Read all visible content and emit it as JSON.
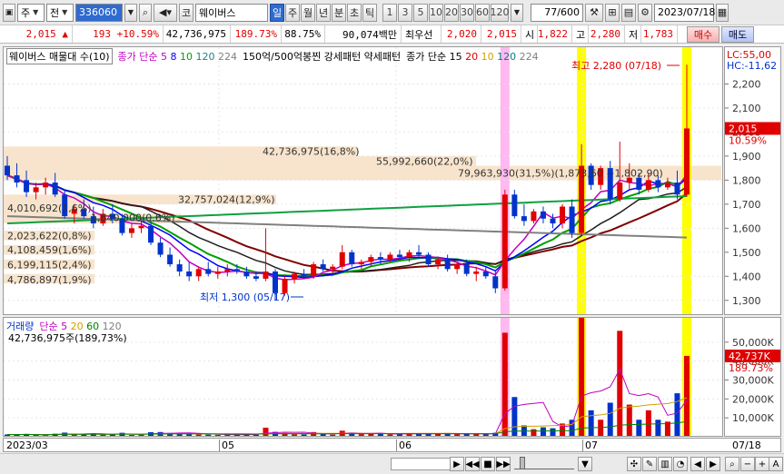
{
  "toolbar": {
    "market": "주",
    "type": "전",
    "code": "336060",
    "stock_prefix": "코",
    "stock_name": "웨이버스",
    "periods": [
      "일",
      "주",
      "월",
      "년",
      "분",
      "초",
      "틱"
    ],
    "selected_period": "일",
    "intervals": [
      "1",
      "3",
      "5",
      "10",
      "20",
      "30",
      "60",
      "120"
    ],
    "counter": "77/600",
    "date": "2023/07/18"
  },
  "quote": {
    "price": "2,015 ▲",
    "change": "193",
    "change_pct": "+10.59%",
    "volume": "42,736,975",
    "vol_ratio": "189.73%",
    "rate": "88.75%",
    "amount": "90,074백만",
    "priority_label": "최우선",
    "best_ask": "2,020",
    "best_bid": "2,015",
    "open_label": "시",
    "open": "1,822",
    "high_label": "고",
    "high": "2,280",
    "low_label": "저",
    "low": "1,783",
    "buy_label": "매수",
    "sell_label": "매도"
  },
  "price_pane": {
    "legend_title": "웨이버스 매물대 수(10)",
    "ma_label": "종가 단순",
    "ma_periods": [
      "5",
      "8",
      "10",
      "120",
      "224"
    ],
    "pattern_label": "150억/500억봉찐 강세패턴 약세패턴",
    "ma15_label": "종가 단순 15",
    "ma15_periods": [
      "20",
      "10",
      "120",
      "224"
    ],
    "high_annotation": "최고 2,280 (07/18)",
    "low_annotation": "최저 1,300 (05/17)",
    "vp_labels": [
      "42,736,975(16,8%)",
      "55,992,660(22,0%)",
      "79,963,930(31,5%)(1,873,60 ~1,802,90)",
      "32,757,024(12,9%)",
      "4,010,692(1,6%)",
      "1,640,000(0.6%)",
      "2,023,622(0,8%)",
      "4,108,459(1,6%)",
      "6,199,115(2,4%)",
      "4,786,897(1,9%)"
    ]
  },
  "price_axis": {
    "lc": "LC:55,00",
    "hc": "HC:-11,62",
    "ticks": [
      "2,200",
      "2,100",
      "2,000",
      "1,900",
      "1,800",
      "1,700",
      "1,600",
      "1,500",
      "1,400",
      "1,300"
    ],
    "current": "2,015",
    "current_pct": "10.59%"
  },
  "volume_pane": {
    "legend_title": "거래량",
    "ma_label": "단순",
    "ma_periods": [
      "5",
      "20",
      "60",
      "120"
    ],
    "summary": "42,736,975주(189,73%)"
  },
  "volume_axis": {
    "ticks": [
      "50,000K",
      "40,000K",
      "30,000K",
      "20,000K",
      "10,000K"
    ],
    "current": "42,737K",
    "current_pct": "189.73%"
  },
  "x_axis": {
    "labels": [
      "2023/03",
      "05",
      "06",
      "07",
      "07/18"
    ]
  },
  "colors": {
    "up": "#e00000",
    "down": "#0033cc",
    "highlight_yellow": "#ffff00",
    "highlight_pink": "#ffb8f0",
    "volume_profile": "#f8e4cc"
  },
  "chart_data": {
    "type": "candlestick",
    "y_range": [
      1250,
      2300
    ],
    "candles": [
      [
        1860,
        1900,
        1800,
        1820
      ],
      [
        1820,
        1870,
        1770,
        1790
      ],
      [
        1800,
        1840,
        1730,
        1750
      ],
      [
        1750,
        1790,
        1720,
        1770
      ],
      [
        1770,
        1810,
        1740,
        1790
      ],
      [
        1790,
        1830,
        1730,
        1740
      ],
      [
        1740,
        1760,
        1640,
        1650
      ],
      [
        1660,
        1700,
        1620,
        1680
      ],
      [
        1680,
        1720,
        1640,
        1650
      ],
      [
        1650,
        1690,
        1600,
        1620
      ],
      [
        1620,
        1680,
        1610,
        1660
      ],
      [
        1660,
        1700,
        1620,
        1640
      ],
      [
        1640,
        1660,
        1570,
        1580
      ],
      [
        1580,
        1620,
        1560,
        1600
      ],
      [
        1600,
        1640,
        1580,
        1610
      ],
      [
        1610,
        1630,
        1530,
        1540
      ],
      [
        1540,
        1560,
        1480,
        1490
      ],
      [
        1490,
        1520,
        1440,
        1450
      ],
      [
        1450,
        1470,
        1400,
        1420
      ],
      [
        1420,
        1460,
        1380,
        1400
      ],
      [
        1400,
        1440,
        1380,
        1430
      ],
      [
        1430,
        1460,
        1400,
        1410
      ],
      [
        1410,
        1440,
        1390,
        1420
      ],
      [
        1420,
        1450,
        1400,
        1430
      ],
      [
        1430,
        1450,
        1410,
        1420
      ],
      [
        1420,
        1440,
        1390,
        1400
      ],
      [
        1400,
        1420,
        1380,
        1390
      ],
      [
        1390,
        1600,
        1380,
        1420
      ],
      [
        1420,
        1430,
        1300,
        1330
      ],
      [
        1330,
        1400,
        1320,
        1390
      ],
      [
        1390,
        1420,
        1370,
        1410
      ],
      [
        1410,
        1430,
        1390,
        1400
      ],
      [
        1400,
        1460,
        1390,
        1450
      ],
      [
        1450,
        1470,
        1420,
        1430
      ],
      [
        1430,
        1450,
        1410,
        1440
      ],
      [
        1440,
        1530,
        1430,
        1500
      ],
      [
        1500,
        1510,
        1440,
        1450
      ],
      [
        1450,
        1470,
        1430,
        1460
      ],
      [
        1460,
        1490,
        1440,
        1480
      ],
      [
        1480,
        1500,
        1450,
        1470
      ],
      [
        1470,
        1500,
        1460,
        1490
      ],
      [
        1490,
        1510,
        1470,
        1480
      ],
      [
        1480,
        1510,
        1460,
        1500
      ],
      [
        1500,
        1530,
        1480,
        1490
      ],
      [
        1490,
        1500,
        1440,
        1450
      ],
      [
        1450,
        1480,
        1430,
        1470
      ],
      [
        1470,
        1490,
        1420,
        1430
      ],
      [
        1430,
        1460,
        1410,
        1450
      ],
      [
        1450,
        1470,
        1400,
        1410
      ],
      [
        1410,
        1440,
        1380,
        1420
      ],
      [
        1420,
        1440,
        1390,
        1400
      ],
      [
        1400,
        1420,
        1330,
        1350
      ],
      [
        1350,
        1760,
        1340,
        1740
      ],
      [
        1740,
        1760,
        1640,
        1650
      ],
      [
        1650,
        1700,
        1610,
        1630
      ],
      [
        1630,
        1680,
        1620,
        1670
      ],
      [
        1670,
        1690,
        1620,
        1640
      ],
      [
        1640,
        1660,
        1600,
        1620
      ],
      [
        1620,
        1700,
        1600,
        1690
      ],
      [
        1690,
        1720,
        1560,
        1580
      ],
      [
        1580,
        1950,
        1570,
        1860
      ],
      [
        1860,
        1870,
        1760,
        1780
      ],
      [
        1780,
        1860,
        1760,
        1850
      ],
      [
        1850,
        1880,
        1700,
        1720
      ],
      [
        1720,
        1960,
        1710,
        1790
      ],
      [
        1790,
        1870,
        1760,
        1810
      ],
      [
        1810,
        1830,
        1740,
        1760
      ],
      [
        1760,
        1830,
        1750,
        1800
      ],
      [
        1800,
        1820,
        1750,
        1770
      ],
      [
        1770,
        1810,
        1760,
        1790
      ],
      [
        1790,
        1840,
        1720,
        1740
      ],
      [
        1740,
        2280,
        1730,
        2015
      ]
    ],
    "volume": [
      120,
      110,
      140,
      100,
      90,
      160,
      220,
      150,
      130,
      170,
      110,
      120,
      210,
      100,
      110,
      240,
      250,
      200,
      180,
      150,
      120,
      110,
      100,
      120,
      100,
      140,
      110,
      480,
      260,
      200,
      130,
      120,
      250,
      140,
      110,
      320,
      180,
      140,
      160,
      150,
      130,
      140,
      190,
      160,
      170,
      150,
      180,
      140,
      160,
      150,
      140,
      210,
      5500,
      2100,
      600,
      400,
      500,
      450,
      700,
      900,
      8200,
      1400,
      900,
      1800,
      5600,
      1700,
      900,
      1400,
      900,
      800,
      2300,
      4274
    ],
    "volume_ylim": [
      0,
      60000
    ]
  }
}
